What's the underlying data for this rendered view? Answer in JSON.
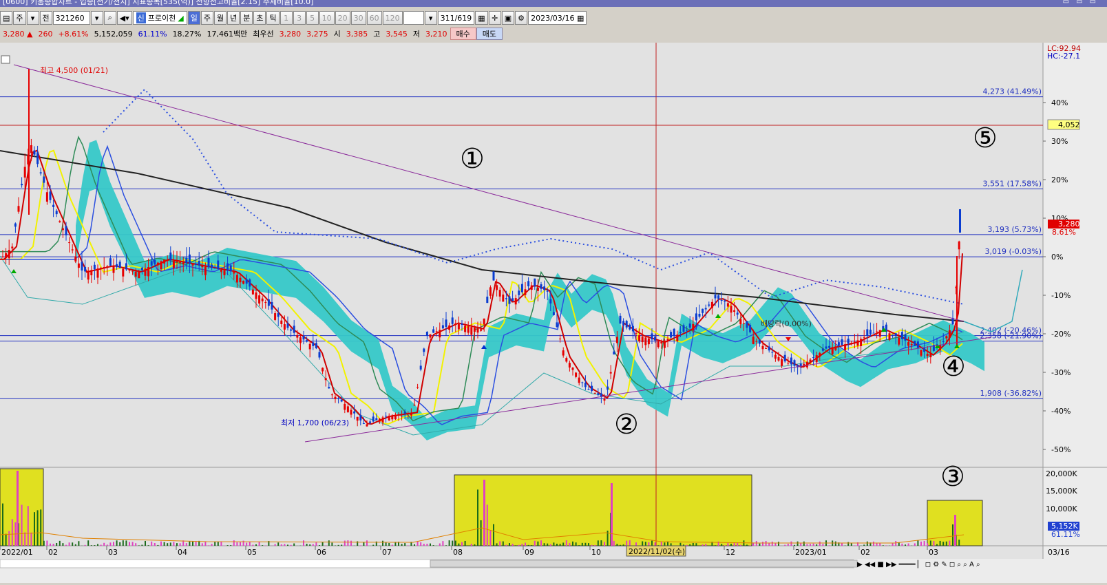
{
  "window": {
    "title": "[0600] 키움종합차트 - 업종[천기/천지] 지표종목[535(억)] 전향전고비율[2.15] 주체비율[10.0]"
  },
  "toolbar": {
    "period_label": "주",
    "prev_label": "전",
    "stock_code": "321260",
    "stock_name": "프로이천",
    "stock_badge": "신",
    "tabs": [
      "일",
      "주",
      "월",
      "년",
      "분",
      "초",
      "틱"
    ],
    "intervals": [
      "1",
      "3",
      "5",
      "10",
      "20",
      "30",
      "60",
      "120"
    ],
    "count_value": "311",
    "count_total": "/619",
    "date_value": "2023/03/16"
  },
  "quote": {
    "price": "3,280 ▲",
    "change": "260",
    "change_pct": "+8.61%",
    "volume": "5,152,059",
    "vol_ratio": "61.11%",
    "turnover": "18.27%",
    "amount": "17,461백만",
    "best_label": "최우선",
    "best_ask": "3,280",
    "best_bid": "3,275",
    "open_label": "시",
    "open": "3,385",
    "high_label": "고",
    "high": "3,545",
    "low_label": "저",
    "low": "3,210",
    "buy_label": "매수",
    "sell_label": "매도"
  },
  "chart": {
    "annotations": {
      "high": "최고 4,500 (01/21)",
      "low": "최저 1,700 (06/23)",
      "ex_dividend": "배당락(0.00%)",
      "circle_1": "①",
      "circle_2": "②",
      "circle_3": "③",
      "circle_4": "④",
      "circle_5": "⑤"
    },
    "level_labels": [
      "4,273 (41.49%)",
      "3,551 (17.58%)",
      "3,193 (5.73%)",
      "3,019 (-0.03%)",
      "2,402 (-20.46%)",
      "2,358 (-21.90%)",
      "1,908 (-36.82%)"
    ],
    "right_top": [
      "LC:92.94",
      "HC:-27.1"
    ],
    "price_tag": "4,052",
    "current_tag": "3,280",
    "current_pct": "8.61%",
    "pct_ticks": [
      "40%",
      "30%",
      "20%",
      "10%",
      "0%",
      "-10%",
      "-20%",
      "-30%",
      "-40%",
      "-50%"
    ],
    "volume_ticks": [
      "20,000K",
      "15,000K",
      "10,000K"
    ],
    "volume_tag": "5,152K",
    "volume_pct": "61.11%",
    "x_ticks": [
      "2022/01",
      "02",
      "03",
      "04",
      "05",
      "06",
      "07",
      "08",
      "09",
      "10",
      "11",
      "12",
      "2023/01",
      "02",
      "03",
      "03/16"
    ],
    "crosshair_date": "2022/11/02(수)"
  },
  "colors": {
    "red_candle": "#e60000",
    "blue_candle": "#0a3cd0",
    "cloud": "#36c8c8",
    "ma_yellow": "#f2f200",
    "ma_black": "#222222",
    "ma_blue": "#2b4fe0",
    "ma_green": "#2e8b57",
    "highlight": "#e0e020",
    "trendline": "#8a2a9a"
  }
}
